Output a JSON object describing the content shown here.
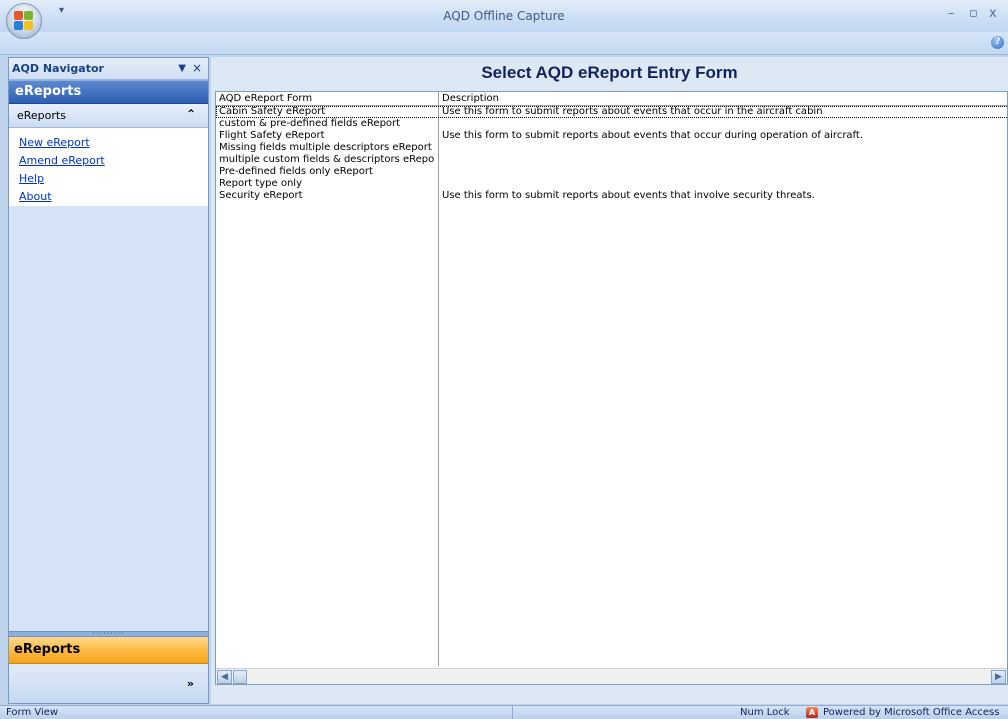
{
  "window": {
    "title": "AQD Offline Capture",
    "minimize": "–",
    "restore": "▫",
    "close": "x",
    "qat_arrow": "▾",
    "help_glyph": "?"
  },
  "navigator": {
    "title": "AQD Navigator",
    "pin_glyph": "▼",
    "close_glyph": "×",
    "group_header": "eReports",
    "group_bar_label": "eReports",
    "group_bar_chevron": "⌃",
    "links": [
      {
        "label": "New eReport"
      },
      {
        "label": "Amend eReport"
      },
      {
        "label": "Help"
      },
      {
        "label": "About"
      }
    ],
    "grip": "·········",
    "bottom_button": "eReports",
    "footer_chevron": "»"
  },
  "form": {
    "title": "Select AQD eReport Entry Form",
    "columns": [
      "AQD eReport Form",
      "Description"
    ],
    "rows": [
      {
        "form": "Cabin Safety eReport",
        "description": "Use this form to submit reports about events that occur in the aircraft cabin",
        "selected": true
      },
      {
        "form": "custom & pre-defined fields eReport",
        "description": ""
      },
      {
        "form": "Flight Safety eReport",
        "description": "Use this form to submit reports about events that occur during operation of aircraft."
      },
      {
        "form": "Missing fields multiple descriptors eReport",
        "description": ""
      },
      {
        "form": "multiple custom fields & descriptors eReport",
        "description": ""
      },
      {
        "form": "Pre-defined fields only eReport",
        "description": ""
      },
      {
        "form": "Report type only",
        "description": ""
      },
      {
        "form": "Security eReport",
        "description": "Use this form to submit reports about events that involve security threats."
      }
    ],
    "scroll_left": "◀",
    "scroll_right": "▶"
  },
  "statusbar": {
    "view": "Form View",
    "num_lock": "Num Lock",
    "powered_by": "Powered by Microsoft Office Access"
  },
  "colors": {
    "accent": "#15428b",
    "nav_active": "#fbb93f",
    "group_header": "#2d5fb3"
  }
}
